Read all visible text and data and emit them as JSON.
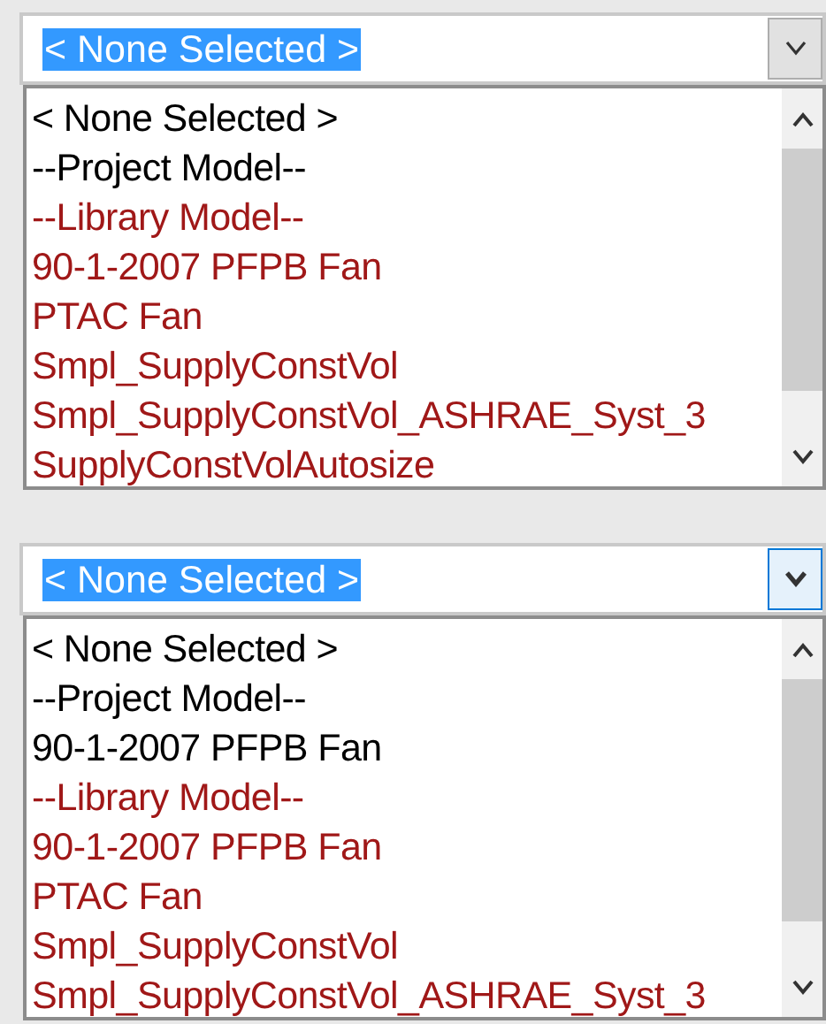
{
  "dropdowns": [
    {
      "value": "< None Selected >",
      "button_active": false,
      "items": [
        {
          "label": "< None Selected >",
          "color": "#000000"
        },
        {
          "label": "--Project Model--",
          "color": "#000000"
        },
        {
          "label": "--Library Model--",
          "color": "#a01818"
        },
        {
          "label": "90-1-2007 PFPB Fan",
          "color": "#a01818"
        },
        {
          "label": "PTAC Fan",
          "color": "#a01818"
        },
        {
          "label": "Smpl_SupplyConstVol",
          "color": "#a01818"
        },
        {
          "label": "Smpl_SupplyConstVol_ASHRAE_Syst_3",
          "color": "#a01818"
        },
        {
          "label": "SupplyConstVolAutosize",
          "color": "#a01818"
        }
      ]
    },
    {
      "value": "< None Selected >",
      "button_active": true,
      "items": [
        {
          "label": "< None Selected >",
          "color": "#000000"
        },
        {
          "label": "--Project Model--",
          "color": "#000000"
        },
        {
          "label": "90-1-2007 PFPB Fan",
          "color": "#000000"
        },
        {
          "label": "--Library Model--",
          "color": "#a01818"
        },
        {
          "label": "90-1-2007 PFPB Fan",
          "color": "#a01818"
        },
        {
          "label": "PTAC Fan",
          "color": "#a01818"
        },
        {
          "label": "Smpl_SupplyConstVol",
          "color": "#a01818"
        },
        {
          "label": "Smpl_SupplyConstVol_ASHRAE_Syst_3",
          "color": "#a01818"
        }
      ]
    }
  ]
}
